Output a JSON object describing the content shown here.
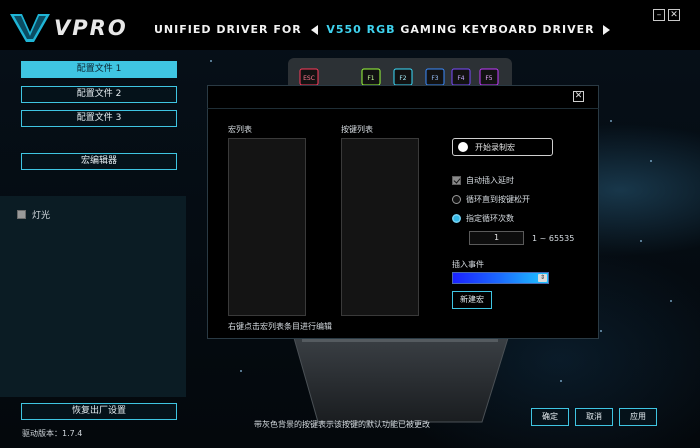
{
  "header": {
    "brand": "VPRO",
    "title_pre": "UNIFIED DRIVER FOR",
    "title_model": "V550 RGB",
    "title_post": "GAMING KEYBOARD DRIVER",
    "minimize_glyph": "–",
    "close_glyph": "✕"
  },
  "sidebar": {
    "profiles": [
      {
        "label": "配置文件 1",
        "active": true
      },
      {
        "label": "配置文件 2",
        "active": false
      },
      {
        "label": "配置文件 3",
        "active": false
      }
    ],
    "macro_editor_label": "宏编辑器",
    "light_label": "灯光",
    "reset_label": "恢复出厂设置",
    "version_label": "驱动版本：1.7.4"
  },
  "keyboard": {
    "keys": [
      "ESC",
      "F1",
      "F2",
      "F3",
      "F4",
      "F5"
    ]
  },
  "dialog": {
    "close_glyph": "✕",
    "macro_list_label": "宏列表",
    "key_list_label": "按键列表",
    "hint": "右键点击宏列表条目进行编辑",
    "record_label": "开始录制宏",
    "auto_delay_label": "自动插入延时",
    "loop_until_release_label": "循环直到按键松开",
    "loop_count_label": "指定循环次数",
    "loop_count_value": "1",
    "loop_range": "1 ~ 65535",
    "insert_event_label": "插入事件",
    "new_macro_label": "新建宏"
  },
  "footer": {
    "note": "带灰色背景的按键表示该按键的默认功能已被更改",
    "ok_label": "确定",
    "cancel_label": "取消",
    "apply_label": "应用"
  },
  "colors": {
    "accent": "#3fc5e2",
    "title_highlight": "#3fd3ef"
  }
}
